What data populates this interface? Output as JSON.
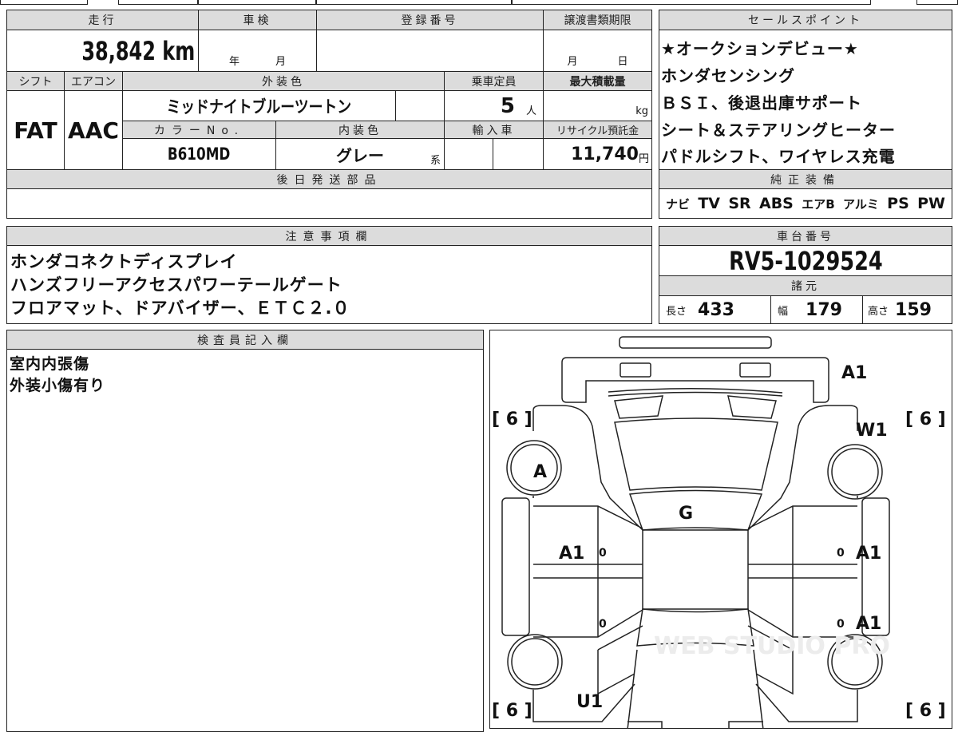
{
  "main_table": {
    "mileage_label": "走行",
    "inspection_label": "車検",
    "registration_label": "登録番号",
    "transfer_deadline_label": "譲渡書類期限",
    "mileage_value": "38,842 km",
    "inspection_year": "年",
    "inspection_month": "月",
    "deadline_month": "月",
    "deadline_day": "日",
    "shift_label": "シフト",
    "ac_label": "エアコン",
    "exterior_color_label": "外装色",
    "capacity_label": "乗車定員",
    "max_load_label": "最大積載量",
    "shift_value": "FAT",
    "ac_value": "AAC",
    "exterior_color_value": "ミッドナイトブルーツートン",
    "capacity_value": "5",
    "capacity_unit": "人",
    "max_load_unit": "kg",
    "color_no_label": "カラーNo.",
    "interior_color_label": "内装色",
    "import_label": "輸入車",
    "recycle_label": "リサイクル預託金",
    "color_no_value": "B610MD",
    "interior_color_value": "グレー",
    "interior_color_suffix": "系",
    "recycle_value": "11,740",
    "recycle_unit": "円",
    "later_parts_label": "後日発送部品"
  },
  "sales_points": {
    "label": "セールスポイント",
    "items": [
      "★オークションデビュー★",
      "ホンダセンシング",
      "ＢＳＩ、後退出庫サポート",
      "シート＆ステアリングヒーター",
      "パドルシフト、ワイヤレス充電"
    ]
  },
  "equipment": {
    "label": "純正装備",
    "items": [
      "ナビ",
      "TV",
      "SR",
      "ABS",
      "エアB",
      "アルミ",
      "PS",
      "PW"
    ]
  },
  "notes": {
    "label": "注意事項欄",
    "lines": [
      "ホンダコネクトディスプレイ",
      "ハンズフリーアクセスパワーテールゲート",
      "フロアマット、ドアバイザー、ＥＴＣ２.０"
    ]
  },
  "chassis": {
    "label": "車台番号",
    "value": "RV5-1029524",
    "specs_label": "諸元",
    "length_label": "長さ",
    "length": "433",
    "width_label": "幅",
    "width": "179",
    "height_label": "高さ",
    "height": "159"
  },
  "inspector": {
    "label": "検査員記入欄",
    "lines": [
      "室内内張傷",
      "外装小傷有り"
    ]
  },
  "diagram": {
    "tire_tread": [
      "[ 6 ]",
      "[ 6 ]",
      "[ 6 ]",
      "[ 6 ]"
    ],
    "marks": {
      "front_bumper": "A1",
      "front_right_fender": "W1",
      "front_left_wheel": "A",
      "windshield": "G",
      "front_left_door": "A1",
      "front_right_door": "A1",
      "rear_right_door": "A1",
      "rear_left_fender": "U1"
    },
    "zeros": [
      "0",
      "0",
      "0",
      "0"
    ],
    "watermark": "WEB STUDIO PRO"
  }
}
